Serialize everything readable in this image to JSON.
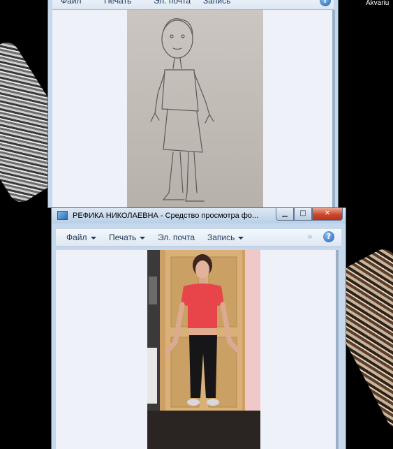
{
  "desktop": {
    "label": "Akvariu"
  },
  "back_window": {
    "menu": [
      "Файл",
      "Печать",
      "Эл. почта",
      "Запись"
    ],
    "photo_alt": "pencil drawing of a figure"
  },
  "front_window": {
    "title": "РЕФИКА НИКОЛАЕВНА - Средство просмотра фо...",
    "menu": {
      "file": "Файл",
      "print": "Печать",
      "email": "Эл. почта",
      "burn": "Запись"
    },
    "help_glyph": "?",
    "overflow_glyph": "»",
    "icons": {
      "title": "photo-viewer-icon",
      "minimize": "minimize-icon",
      "maximize": "maximize-icon",
      "close": "close-icon",
      "help": "help-icon"
    }
  },
  "colors": {
    "window_frame": "#c6d8ec",
    "command_text": "#1e395b",
    "close_button": "#c9482c"
  }
}
